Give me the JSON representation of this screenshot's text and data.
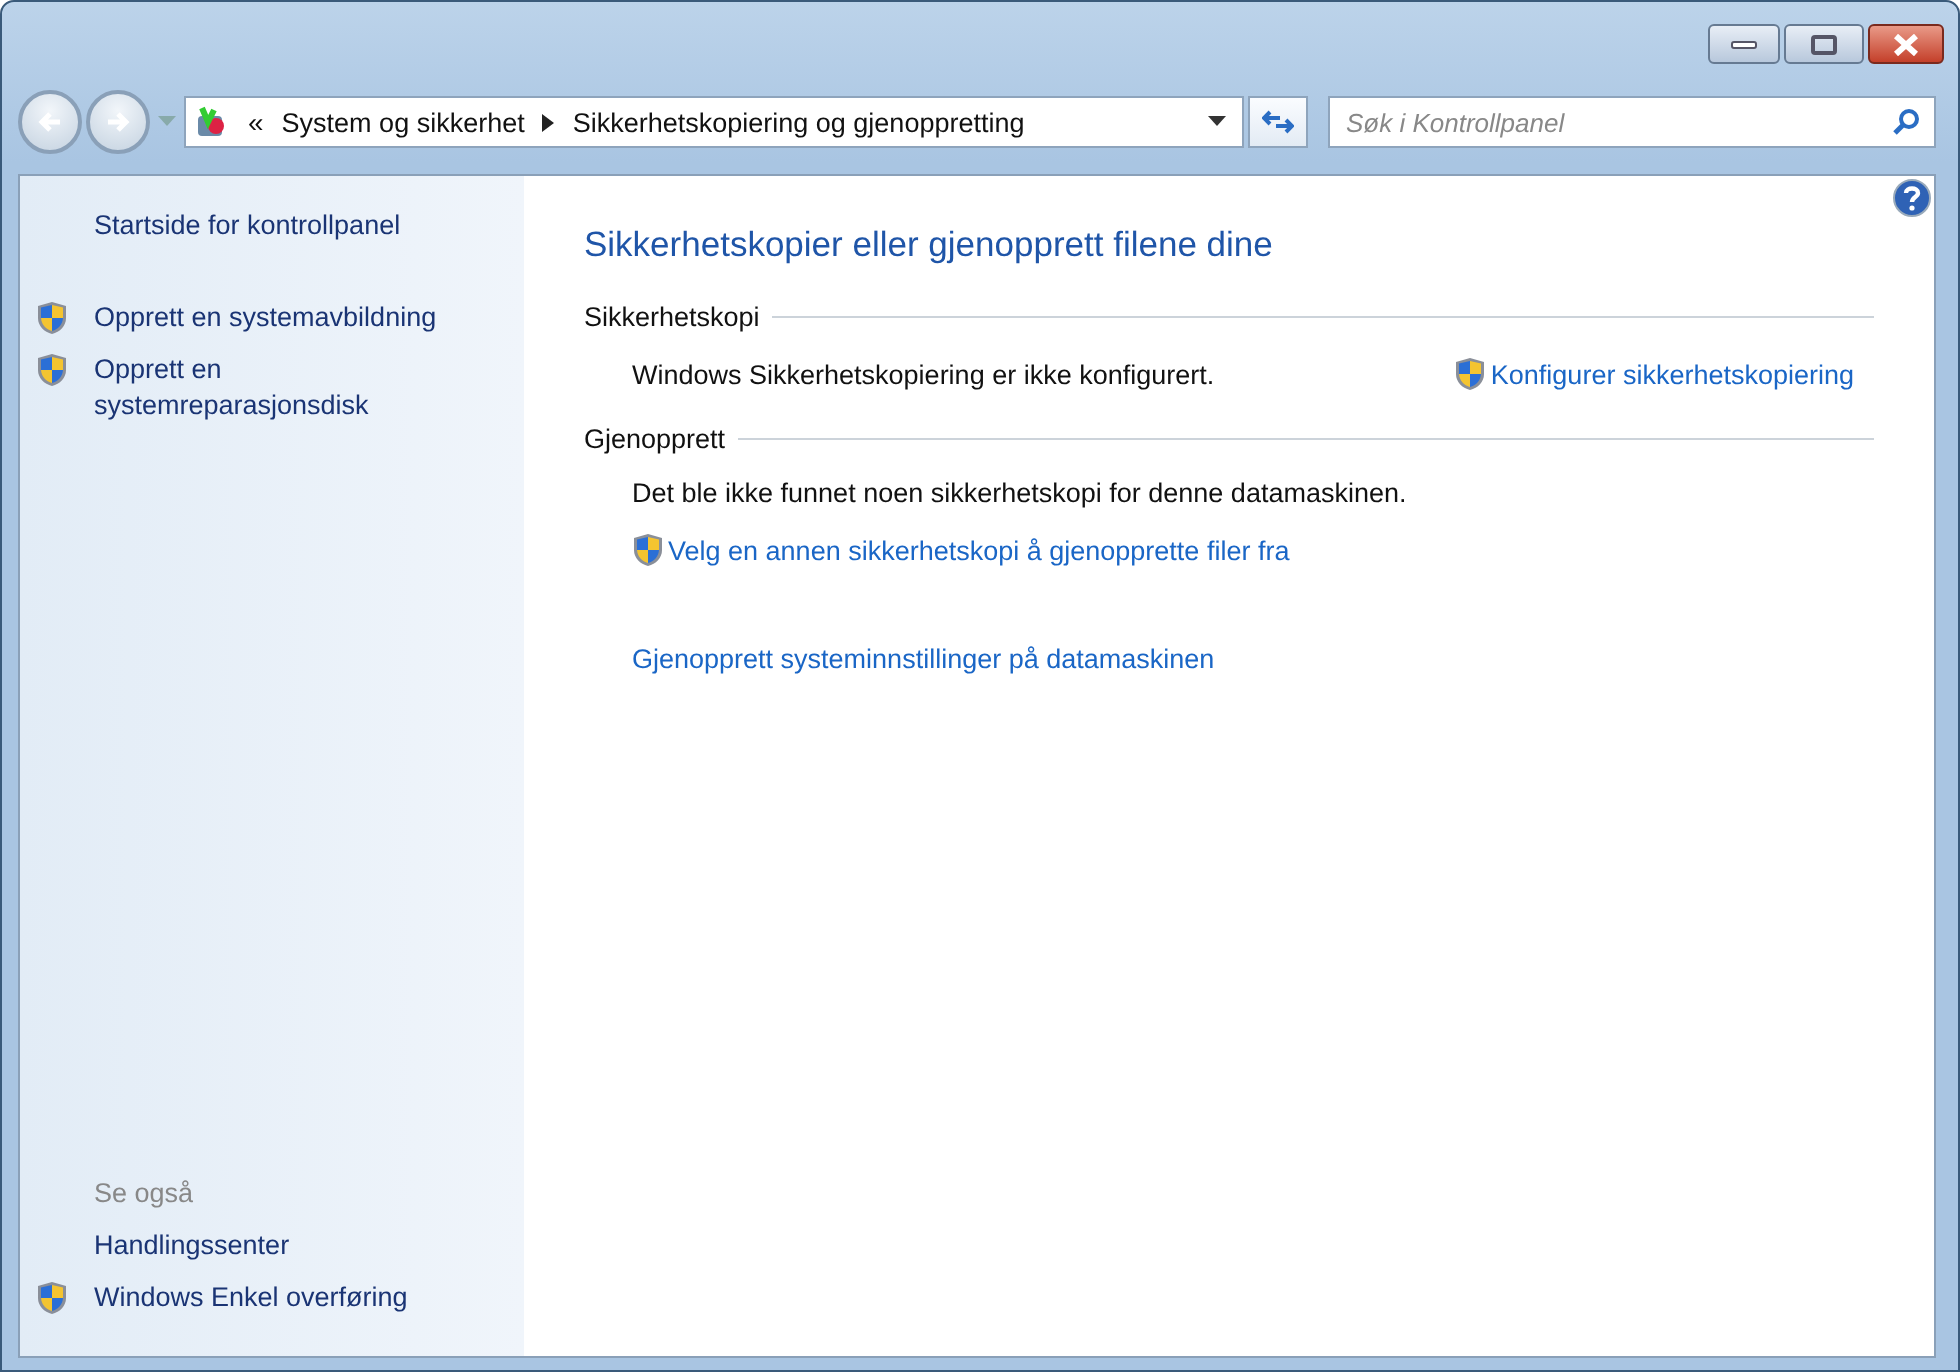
{
  "address_bar": {
    "overflow": "«",
    "crumbs": [
      "System og sikkerhet",
      "Sikkerhetskopiering og gjenoppretting"
    ]
  },
  "search": {
    "placeholder": "Søk i Kontrollpanel"
  },
  "sidebar": {
    "items": [
      {
        "label": "Startside for kontrollpanel",
        "shield": false
      },
      {
        "label": "Opprett en systemavbildning",
        "shield": true
      },
      {
        "label": "Opprett en systemreparasjonsdisk",
        "shield": true
      }
    ],
    "see_also": {
      "heading": "Se også",
      "items": [
        {
          "label": "Handlingssenter",
          "shield": false
        },
        {
          "label": "Windows Enkel overføring",
          "shield": true
        }
      ]
    }
  },
  "main": {
    "title": "Sikkerhetskopier eller gjenopprett filene dine",
    "sections": [
      {
        "heading": "Sikkerhetskopi",
        "inline": true,
        "status": "Windows Sikkerhetskopiering er ikke konfigurert.",
        "links": [
          {
            "label": "Konfigurer sikkerhetskopiering",
            "shield": true
          }
        ]
      },
      {
        "heading": "Gjenopprett",
        "inline": false,
        "status": "Det ble ikke funnet noen sikkerhetskopi for denne datamaskinen.",
        "links": [
          {
            "label": "Velg en annen sikkerhetskopi å gjenopprette filer fra",
            "shield": true
          }
        ],
        "more_links": [
          {
            "label": "Gjenopprett systeminnstillinger på datamaskinen",
            "shield": false
          }
        ]
      }
    ]
  }
}
